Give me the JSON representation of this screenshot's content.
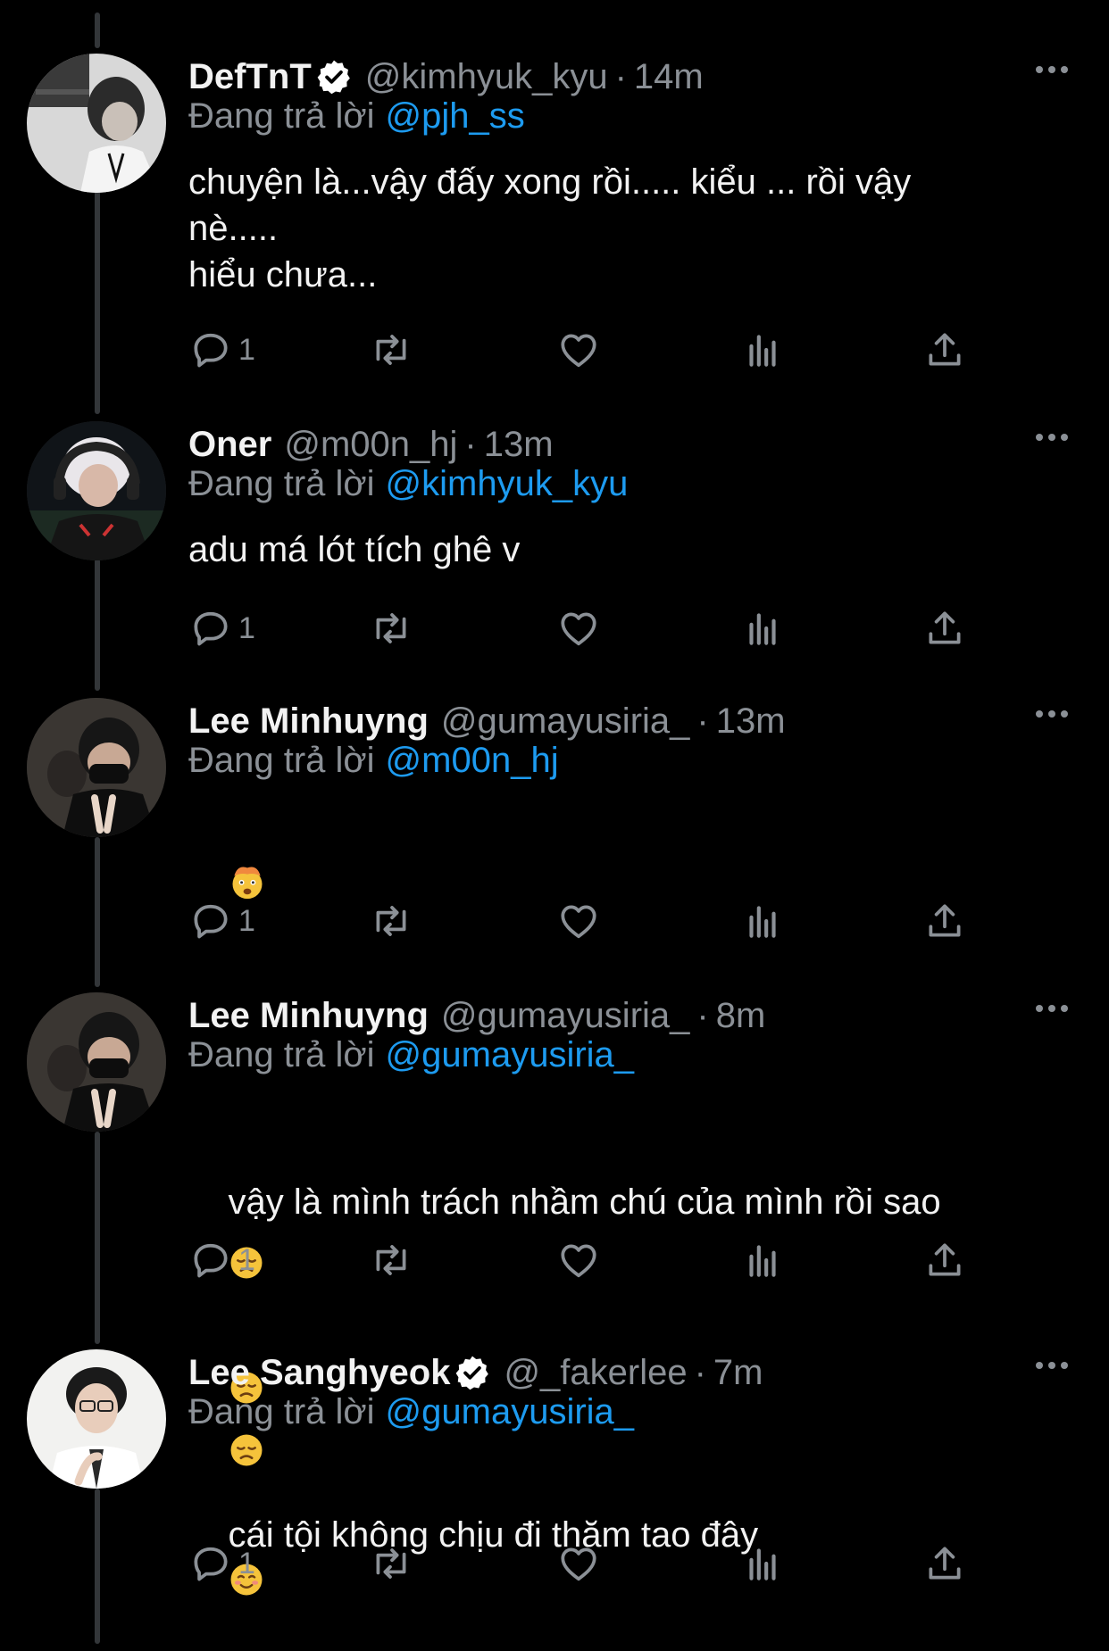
{
  "colors": {
    "background": "#000000",
    "name": "#f2f2f2",
    "secondary": "#8b9096",
    "link": "#1d9bf0",
    "verified": "#ffffff",
    "thread_line": "#333639"
  },
  "tweets": [
    {
      "display_name": "DefTnT",
      "verified": true,
      "handle": "@kimhyuk_kyu",
      "separator": "·",
      "time": "14m",
      "reply_prefix": "Đang trả lời",
      "reply_to": "@pjh_ss",
      "text": "chuyện là...vậy đấy xong rồi..... kiểu ... rồi vậy\nnè.....\nhiểu chưa...",
      "reply_count": "1",
      "avatar_icon": "avatar-photo-grayscale"
    },
    {
      "display_name": "Oner",
      "verified": false,
      "handle": "@m00n_hj",
      "separator": "·",
      "time": "13m",
      "reply_prefix": "Đang trả lời",
      "reply_to": "@kimhyuk_kyu",
      "text": "adu má lót tích ghê v",
      "reply_count": "1",
      "avatar_icon": "avatar-photo-headset"
    },
    {
      "display_name": "Lee Minhuyng",
      "verified": false,
      "handle": "@gumayusiria_",
      "separator": "·",
      "time": "13m",
      "reply_prefix": "Đang trả lời",
      "reply_to": "@m00n_hj",
      "text": "",
      "emojis": [
        "exploding-head-emoji"
      ],
      "reply_count": "1",
      "avatar_icon": "avatar-photo-mask"
    },
    {
      "display_name": "Lee Minhuyng",
      "verified": false,
      "handle": "@gumayusiria_",
      "separator": "·",
      "time": "8m",
      "reply_prefix": "Đang trả lời",
      "reply_to": "@gumayusiria_",
      "text": "vậy là mình trách nhầm chú của mình rồi sao",
      "emojis": [
        "disappointed-face-emoji",
        "disappointed-face-emoji",
        "disappointed-face-emoji"
      ],
      "reply_count": "1",
      "avatar_icon": "avatar-photo-mask"
    },
    {
      "display_name": "Lee Sanghyeok",
      "verified": true,
      "handle": "@_fakerlee",
      "separator": "·",
      "time": "7m",
      "reply_prefix": "Đang trả lời",
      "reply_to": "@gumayusiria_",
      "text": "cái tội không chịu đi thăm tao đây",
      "emojis": [
        "smiling-face-emoji"
      ],
      "reply_count": "1",
      "avatar_icon": "avatar-photo-portrait"
    }
  ],
  "action_icons": [
    "reply-icon",
    "retweet-icon",
    "like-icon",
    "views-icon",
    "share-icon"
  ]
}
